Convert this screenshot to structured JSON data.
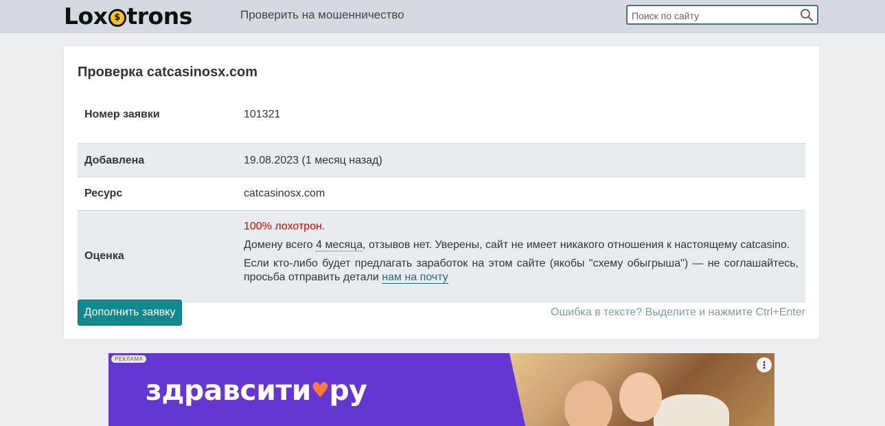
{
  "header": {
    "logo_left": "Lox",
    "logo_right": "trons",
    "nav_link": "Проверить на мошенничество",
    "search_placeholder": "Поиск по сайту"
  },
  "card": {
    "title": "Проверка catcasinosx.com",
    "rows": [
      {
        "key": "Номер заявки",
        "value": "101321"
      },
      {
        "key": "Добавлена",
        "value": "19.08.2023 (1 месяц назад)"
      },
      {
        "key": "Ресурс",
        "value": "catcasinosx.com"
      },
      {
        "key": "Оценка"
      }
    ],
    "assessment": {
      "verdict": "100% лохотрон.",
      "line2_prefix": "Домену всего ",
      "line2_link": "4 месяца",
      "line2_suffix": ", отзывов нет. Уверены, сайт не имеет никакого отношения к настоящему catcasino.",
      "line3_prefix": "Если кто-либо будет предлагать заработок на этом сайте (якобы \"схему обыгрыша\") — не соглашайтесь, просьба отправить детали ",
      "line3_link": "нам на почту"
    },
    "button_label": "Дополнить заявку",
    "hint": "Ошибка в тексте? Выделите и нажмите Ctrl+Enter"
  },
  "ad": {
    "badge": "РЕКЛАМА",
    "brand_left": "здравсити",
    "brand_right": "ру",
    "menu_glyph": "⋮"
  },
  "colors": {
    "accent": "#108a8f",
    "verdict": "#e00000",
    "ad_bg": "#6437d3"
  }
}
